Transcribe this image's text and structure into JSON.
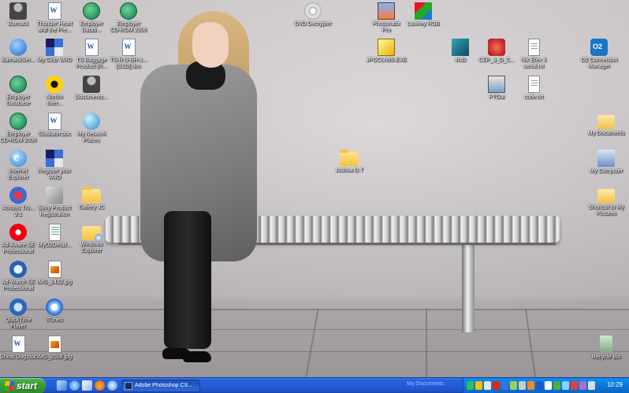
{
  "desktop": {
    "icons": [
      {
        "label": "Barnack",
        "kind": "person"
      },
      {
        "label": "Thunder Heart\nand the Pre...",
        "kind": "doc"
      },
      {
        "label": "Employer\nDatab...",
        "kind": "green"
      },
      {
        "label": "Employer\nCD-ROM 2006",
        "kind": "green"
      },
      {
        "label": "DVD Decrypter",
        "kind": "disc"
      },
      {
        "label": "Photomatix\nPro",
        "kind": "photomatix"
      },
      {
        "label": "Lowkey RGB",
        "kind": "lowkey"
      },
      {
        "label": "BarnackSet...",
        "kind": "globe"
      },
      {
        "label": "My Club VAIO",
        "kind": "vaio"
      },
      {
        "label": "TS Baggage\nProduct (R...",
        "kind": "doc"
      },
      {
        "label": "TS-R-U-BH-1...\n[SSD].doc",
        "kind": "doc"
      },
      {
        "label": "JPGCLN95.EXE",
        "kind": "exe"
      },
      {
        "label": "4IsD",
        "kind": "teal"
      },
      {
        "label": "CEP_3_D_C...",
        "kind": "red"
      },
      {
        "label": "Nik Efex 3\nserial.txt",
        "kind": "txt"
      },
      {
        "label": "O2 Connection\nManager",
        "kind": "o2"
      },
      {
        "label": "Employer\nDatabase",
        "kind": "green"
      },
      {
        "label": "Norton\nInter...",
        "kind": "norton"
      },
      {
        "label": "Documents...",
        "kind": "person"
      },
      {
        "label": "PTGui",
        "kind": "ptgui"
      },
      {
        "label": "code.txt",
        "kind": "txt"
      },
      {
        "label": "Employer\nCD-ROM 2006",
        "kind": "green"
      },
      {
        "label": "Gladiator.doc",
        "kind": "doc"
      },
      {
        "label": "My Network\nPlaces",
        "kind": "net"
      },
      {
        "label": "My Documents",
        "kind": "docs"
      },
      {
        "label": "Internet\nExplorer",
        "kind": "ie"
      },
      {
        "label": "Register your\nVAIO",
        "kind": "vaio"
      },
      {
        "label": "Joshua D.T",
        "kind": "folder"
      },
      {
        "label": "My Computer",
        "kind": "mycomp"
      },
      {
        "label": "Acronis Tru...\n9.1",
        "kind": "acronis"
      },
      {
        "label": "Sony Product\nRegistration",
        "kind": "sony"
      },
      {
        "label": "Gallery JC",
        "kind": "folder"
      },
      {
        "label": "Shortcut to My\nPictures",
        "kind": "docs"
      },
      {
        "label": "Ad-Aware SE\nProfessional",
        "kind": "adaware"
      },
      {
        "label": "MyO2Detail...",
        "kind": "doc-alt"
      },
      {
        "label": "Windows\nExplorer",
        "kind": "winexp"
      },
      {
        "label": "Ad-Watch SE\nProfessional",
        "kind": "adwatch"
      },
      {
        "label": "IMG_2432.jpg",
        "kind": "jpg"
      },
      {
        "label": "QuickTime\nPlayer",
        "kind": "qt"
      },
      {
        "label": "iTunes",
        "kind": "itunes"
      },
      {
        "label": "Ghost Dog.doc",
        "kind": "doc"
      },
      {
        "label": "IMG_2508.jpg",
        "kind": "jpg"
      },
      {
        "label": "Recycle Bin",
        "kind": "bin"
      }
    ]
  },
  "taskbar": {
    "start_label": "start",
    "quick_launch": [
      "show-desktop-icon",
      "internet-explorer-icon",
      "email-icon",
      "firefox-icon",
      "internet-explorer-icon"
    ],
    "active_task": "Adobe Photoshop CS...",
    "toolbar_label": "My Documents",
    "clock": "10:29"
  },
  "colors": {
    "taskbar_blue": "#245edb",
    "start_green": "#3c9d35",
    "tray_blue": "#0b77d8"
  }
}
